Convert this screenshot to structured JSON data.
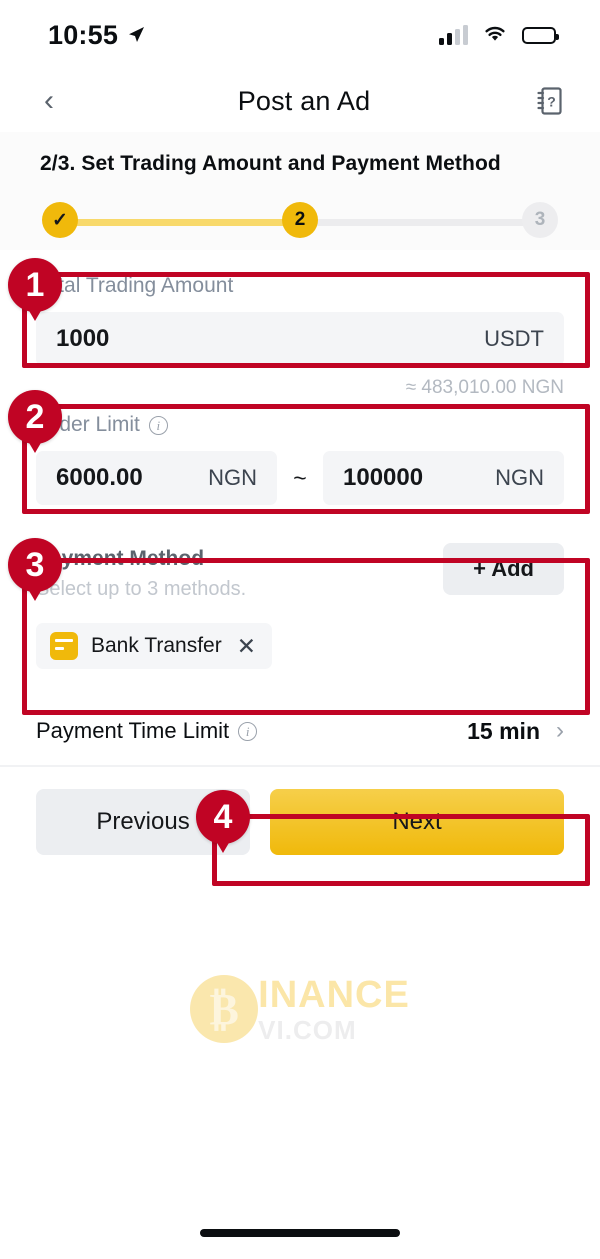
{
  "status_bar": {
    "time": "10:55",
    "location_arrow": "➤",
    "icons": [
      "signal-bars",
      "wifi",
      "battery"
    ]
  },
  "nav": {
    "back_icon": "‹",
    "title": "Post an Ad",
    "help_icon": "help-guide-icon"
  },
  "step": {
    "title": "2/3. Set Trading Amount and Payment Method",
    "steps": [
      {
        "label": "✓",
        "state": "completed"
      },
      {
        "label": "2",
        "state": "active"
      },
      {
        "label": "3",
        "state": "inactive"
      }
    ]
  },
  "total_trading_amount": {
    "label": "Total Trading Amount",
    "value": "1000",
    "unit": "USDT",
    "converted": "≈ 483,010.00 NGN"
  },
  "order_limit": {
    "label": "Order Limit",
    "info_icon": "i",
    "min_value": "6000.00",
    "min_unit": "NGN",
    "separator": "~",
    "max_value": "100000",
    "max_unit": "NGN"
  },
  "payment_method": {
    "title": "Payment Method",
    "subtitle": "Select up to 3 methods.",
    "add_label": "+ Add",
    "chips": [
      {
        "label": "Bank Transfer",
        "icon": "bank-card-icon",
        "remove_icon": "✕"
      }
    ]
  },
  "payment_time_limit": {
    "label": "Payment Time Limit",
    "info_icon": "i",
    "value": "15 min",
    "chevron": "›"
  },
  "actions": {
    "previous_label": "Previous",
    "next_label": "Next"
  },
  "watermark": {
    "coin_glyph": "₿",
    "main_text": "INANCE",
    "sub_text": "VI.COM"
  },
  "annotations": [
    {
      "number": "1"
    },
    {
      "number": "2"
    },
    {
      "number": "3"
    },
    {
      "number": "4"
    }
  ],
  "colors": {
    "accent_yellow": "#f0b90b",
    "annotation_red": "#c00424",
    "field_bg": "#f4f5f7",
    "text_primary": "#0b0e11",
    "text_muted": "#848e9c"
  }
}
